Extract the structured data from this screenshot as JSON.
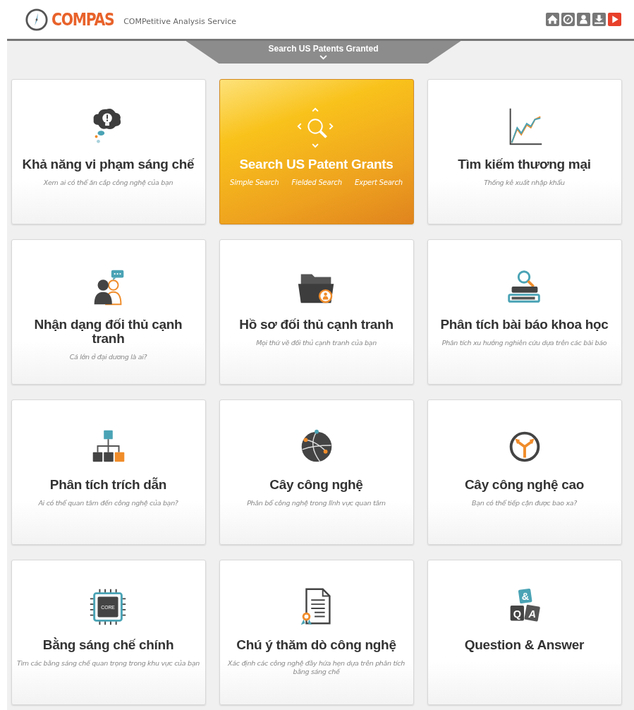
{
  "header": {
    "brand": "COMPAS",
    "tagline": "COMPetitive Analysis Service",
    "toolbar": [
      {
        "kind": "home"
      },
      {
        "kind": "compass"
      },
      {
        "kind": "user"
      },
      {
        "kind": "download"
      },
      {
        "kind": "play"
      }
    ]
  },
  "tab": {
    "label": "Search US Patents Granted"
  },
  "cards": [
    {
      "kind": "idea",
      "title": "Khả năng vi phạm sáng chế",
      "subtitle": "Xem ai có thể ăn cắp công nghệ của bạn",
      "highlighted": false
    },
    {
      "kind": "search",
      "title": "Search US Patent Grants",
      "links": [
        "Simple Search",
        "Fielded Search",
        "Expert Search"
      ],
      "highlighted": true
    },
    {
      "kind": "chart",
      "title": "Tìm kiếm thương mại",
      "subtitle": "Thống kê xuất nhập khẩu",
      "highlighted": false
    },
    {
      "kind": "people",
      "title": "Nhận dạng đối thủ cạnh tranh",
      "subtitle": "Cá lớn ở đại dương là ai?",
      "highlighted": false
    },
    {
      "kind": "folder",
      "title": "Hồ sơ đối thủ cạnh tranh",
      "subtitle": "Mọi thứ về đối thủ cạnh tranh của bạn",
      "highlighted": false
    },
    {
      "kind": "books",
      "title": "Phân tích bài báo khoa học",
      "subtitle": "Phân tích xu hướng nghiên cứu dựa trên các bài báo",
      "highlighted": false
    },
    {
      "kind": "hierarchy",
      "title": "Phân tích trích dẫn",
      "subtitle": "Ai có thể quan tâm đến công nghệ của bạn?",
      "highlighted": false
    },
    {
      "kind": "globe",
      "title": "Cây công nghệ",
      "subtitle": "Phân bổ công nghệ trong lĩnh vực quan tâm",
      "highlighted": false
    },
    {
      "kind": "fork",
      "title": "Cây công nghệ cao",
      "subtitle": "Bạn có thể tiếp cận được bao xa?",
      "highlighted": false
    },
    {
      "kind": "chip",
      "icon_text": [
        "CORE"
      ],
      "title": "Bằng sáng chế chính",
      "subtitle": "Tìm các bằng sáng chế quan trọng trong khu vực của bạn",
      "highlighted": false
    },
    {
      "kind": "certificate",
      "title": "Chú ý thăm dò công nghệ",
      "subtitle": "Xác định các công nghệ đầy hứa hẹn dựa trên phân tích bằng sáng chế",
      "highlighted": false
    },
    {
      "kind": "qa",
      "icon_text": [
        "&",
        "Q",
        "A"
      ],
      "title": "Question & Answer",
      "highlighted": false
    }
  ]
}
